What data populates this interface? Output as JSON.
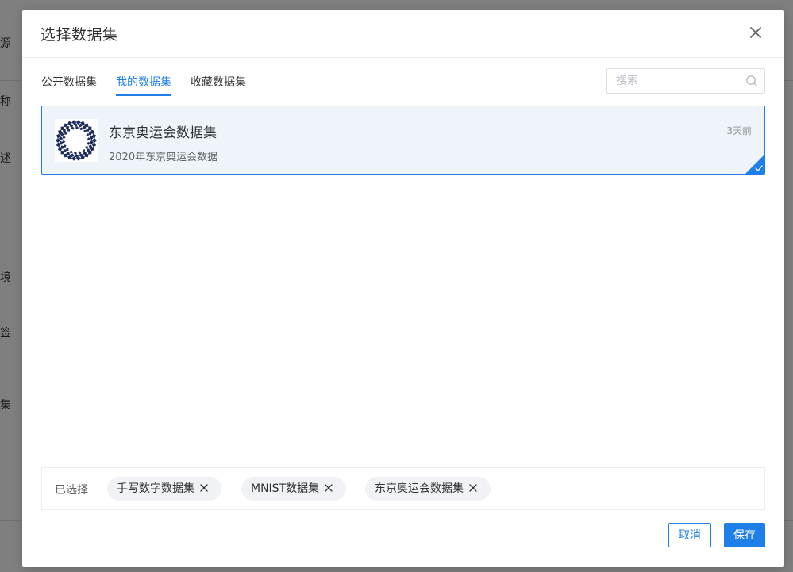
{
  "background": {
    "labels": [
      "源",
      "称",
      "述",
      "境",
      "签",
      "集"
    ]
  },
  "dialog": {
    "title": "选择数据集",
    "tabs": [
      {
        "label": "公开数据集",
        "active": false
      },
      {
        "label": "我的数据集",
        "active": true
      },
      {
        "label": "收藏数据集",
        "active": false
      }
    ],
    "search": {
      "placeholder": "搜索",
      "value": ""
    },
    "datasets": [
      {
        "name": "东京奥运会数据集",
        "description": "2020年东京奥运会数据",
        "time": "3天前",
        "selected": true,
        "logo_icon": "tokyo-olympics-emblem-icon"
      }
    ],
    "selected": {
      "label": "已选择",
      "items": [
        "手写数字数据集",
        "MNIST数据集",
        "东京奥运会数据集"
      ]
    },
    "buttons": {
      "cancel": "取消",
      "save": "保存"
    }
  },
  "colors": {
    "accent": "#1e7fe8",
    "card_bg": "#eef4fa",
    "emblem": "#1f2d5c",
    "overlay": "rgba(0,0,0,0.5)"
  }
}
